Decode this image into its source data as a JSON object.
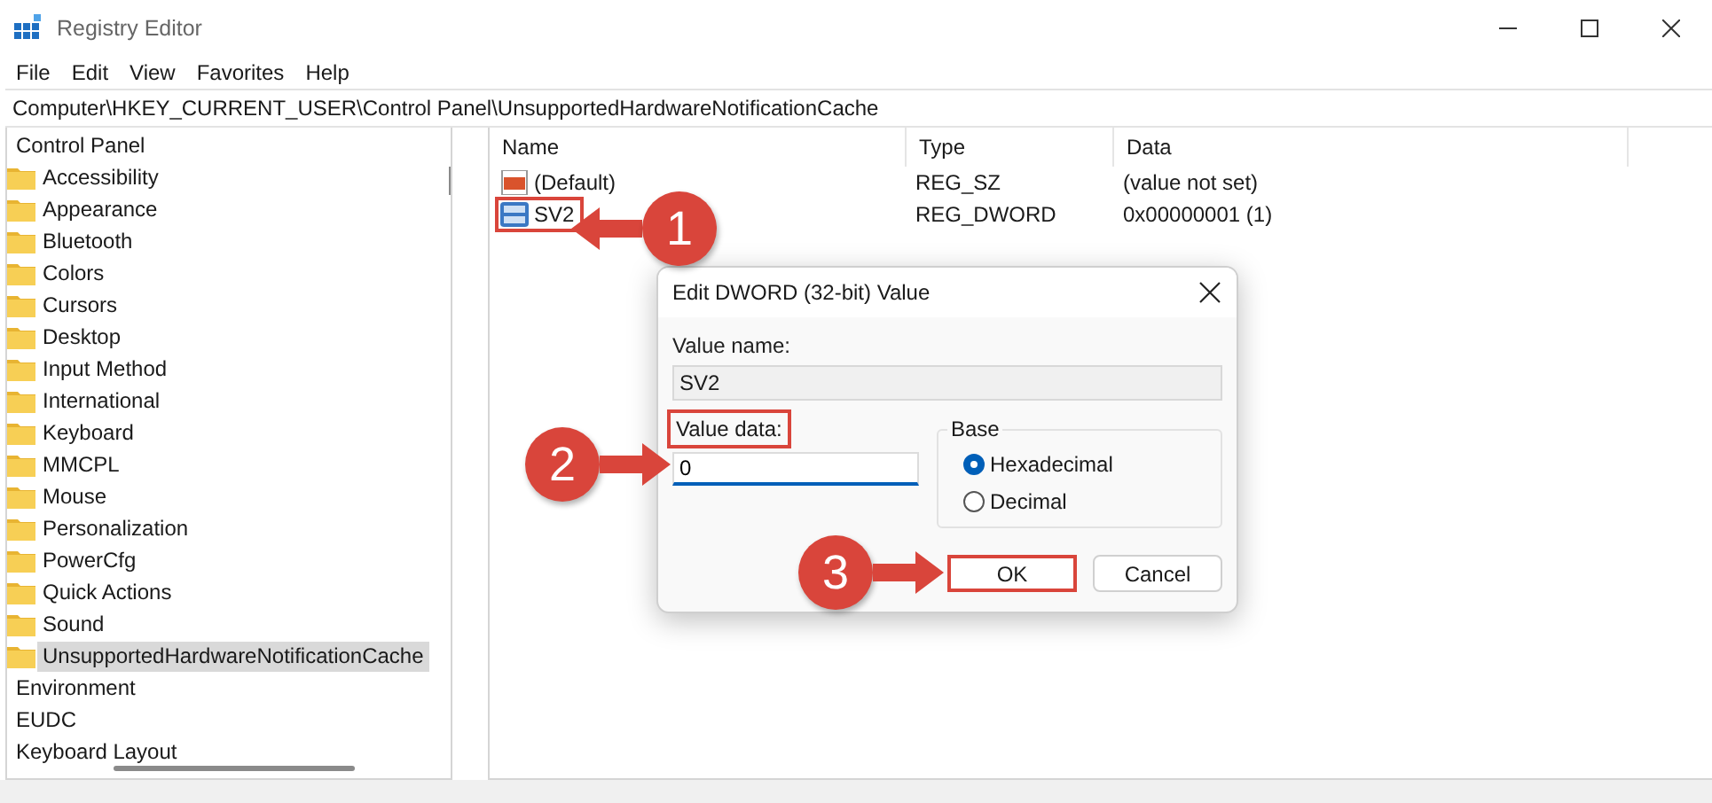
{
  "window": {
    "title": "Registry Editor"
  },
  "menu": [
    "File",
    "Edit",
    "View",
    "Favorites",
    "Help"
  ],
  "address": "Computer\\HKEY_CURRENT_USER\\Control Panel\\UnsupportedHardwareNotificationCache",
  "tree": [
    {
      "label": "Control Panel",
      "selected": false,
      "children": [
        {
          "label": "Accessibility",
          "selected": false
        },
        {
          "label": "Appearance",
          "selected": false
        },
        {
          "label": "Bluetooth",
          "selected": false
        },
        {
          "label": "Colors",
          "selected": false
        },
        {
          "label": "Cursors",
          "selected": false
        },
        {
          "label": "Desktop",
          "selected": false
        },
        {
          "label": "Input Method",
          "selected": false
        },
        {
          "label": "International",
          "selected": false
        },
        {
          "label": "Keyboard",
          "selected": false
        },
        {
          "label": "MMCPL",
          "selected": false
        },
        {
          "label": "Mouse",
          "selected": false
        },
        {
          "label": "Personalization",
          "selected": false
        },
        {
          "label": "PowerCfg",
          "selected": false
        },
        {
          "label": "Quick Actions",
          "selected": false
        },
        {
          "label": "Sound",
          "selected": false
        },
        {
          "label": "UnsupportedHardwareNotificationCache",
          "selected": true
        }
      ]
    },
    {
      "label": "Environment",
      "selected": false
    },
    {
      "label": "EUDC",
      "selected": false
    },
    {
      "label": "Keyboard Layout",
      "selected": false
    }
  ],
  "table": {
    "columns": [
      "Name",
      "Type",
      "Data"
    ],
    "rows": [
      {
        "kind": "string",
        "name": "(Default)",
        "type": "REG_SZ",
        "data": "(value not set)",
        "highlighted": false
      },
      {
        "kind": "dword",
        "name": "SV2",
        "type": "REG_DWORD",
        "data": "0x00000001 (1)",
        "highlighted": true
      }
    ]
  },
  "dialog": {
    "title": "Edit DWORD (32-bit) Value",
    "value_name_label": "Value name:",
    "value_name": "SV2",
    "value_data_label": "Value data:",
    "value_data_highlighted": true,
    "value_data": "0",
    "base_label": "Base",
    "radios": [
      {
        "label": "Hexadecimal",
        "selected": true
      },
      {
        "label": "Decimal",
        "selected": false
      }
    ],
    "buttons": [
      {
        "label": "OK",
        "highlighted": true
      },
      {
        "label": "Cancel",
        "highlighted": false
      }
    ]
  },
  "callouts": [
    {
      "number": "1",
      "kind": "leftward"
    },
    {
      "number": "2",
      "kind": "rightward"
    },
    {
      "number": "3",
      "kind": "rightward"
    }
  ]
}
